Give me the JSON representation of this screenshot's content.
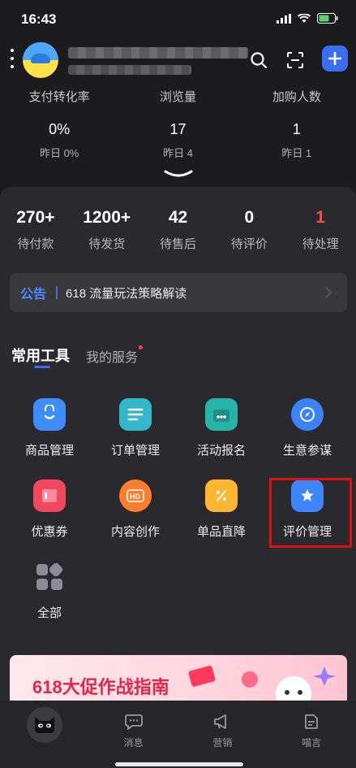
{
  "status_bar": {
    "time": "16:43"
  },
  "header": {
    "avatar": "shop-avatar",
    "shop_name_blurred": true
  },
  "stats": [
    {
      "label": "支付转化率",
      "value": "0%",
      "prev": "昨日 0%"
    },
    {
      "label": "浏览量",
      "value": "17",
      "prev": "昨日 4"
    },
    {
      "label": "加购人数",
      "value": "1",
      "prev": "昨日 1"
    }
  ],
  "orders": [
    {
      "count": "270+",
      "label": "待付款"
    },
    {
      "count": "1200+",
      "label": "待发货"
    },
    {
      "count": "42",
      "label": "待售后"
    },
    {
      "count": "0",
      "label": "待评价"
    },
    {
      "count": "1",
      "label": "待处理",
      "color": "#ff4a4a"
    }
  ],
  "notice": {
    "tag": "公告",
    "text": "618 流量玩法策略解读"
  },
  "tabs": {
    "active": "常用工具",
    "other": "我的服务"
  },
  "tools": [
    {
      "label": "商品管理",
      "icon": "shopping-bag-icon"
    },
    {
      "label": "订单管理",
      "icon": "order-list-icon"
    },
    {
      "label": "活动报名",
      "icon": "activity-signup-icon"
    },
    {
      "label": "生意参谋",
      "icon": "compass-icon"
    },
    {
      "label": "优惠券",
      "icon": "coupon-icon"
    },
    {
      "label": "内容创作",
      "icon": "hd-video-icon"
    },
    {
      "label": "单品直降",
      "icon": "discount-ticket-icon"
    },
    {
      "label": "评价管理",
      "icon": "star-review-icon"
    },
    {
      "label": "全部",
      "icon": "grid-all-icon"
    }
  ],
  "banner": {
    "text": "618大促作战指南"
  },
  "tabbar": [
    {
      "label": "",
      "icon": "home-cat-icon"
    },
    {
      "label": "消息",
      "icon": "message-icon"
    },
    {
      "label": "营销",
      "icon": "megaphone-icon"
    },
    {
      "label": "喵言",
      "icon": "notes-icon"
    }
  ],
  "colors": {
    "accent": "#3a6df0",
    "alert": "#ff4a4a",
    "highlight_box": "#e01010"
  }
}
